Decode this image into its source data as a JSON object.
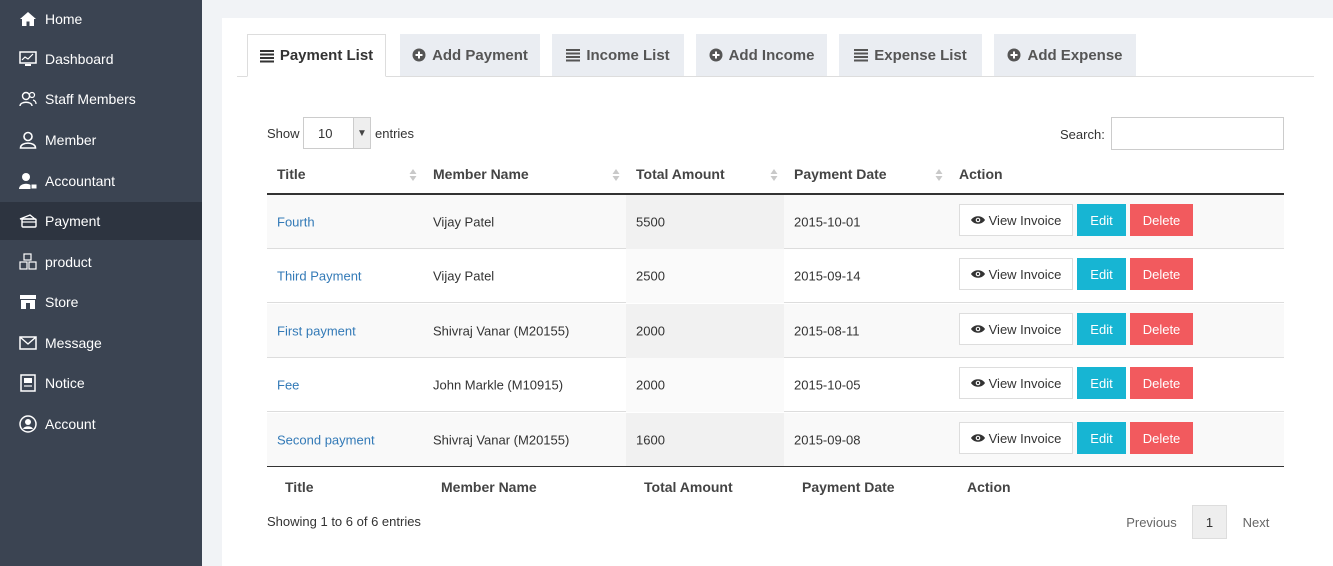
{
  "sidebar": {
    "items": [
      {
        "label": "Home",
        "icon": "home-icon"
      },
      {
        "label": "Dashboard",
        "icon": "monitor-icon"
      },
      {
        "label": "Staff Members",
        "icon": "users-icon"
      },
      {
        "label": "Member",
        "icon": "user-icon"
      },
      {
        "label": "Accountant",
        "icon": "accountant-icon"
      },
      {
        "label": "Payment",
        "icon": "payment-icon",
        "active": true
      },
      {
        "label": "product",
        "icon": "boxes-icon"
      },
      {
        "label": "Store",
        "icon": "store-icon"
      },
      {
        "label": "Message",
        "icon": "envelope-icon"
      },
      {
        "label": "Notice",
        "icon": "notice-icon"
      },
      {
        "label": "Account",
        "icon": "account-icon"
      }
    ]
  },
  "tabs": [
    {
      "label": "Payment List",
      "icon": "list-icon",
      "active": true
    },
    {
      "label": "Add Payment",
      "icon": "plus-circle-icon"
    },
    {
      "label": "Income List",
      "icon": "list-icon"
    },
    {
      "label": "Add Income",
      "icon": "plus-circle-icon"
    },
    {
      "label": "Expense List",
      "icon": "list-icon"
    },
    {
      "label": "Add Expense",
      "icon": "plus-circle-icon"
    }
  ],
  "table": {
    "show_label": "Show",
    "page_size": "10",
    "entries_label": "entries",
    "search_label": "Search:",
    "search_value": "",
    "columns": [
      "Title",
      "Member Name",
      "Total Amount",
      "Payment Date",
      "Action"
    ],
    "rows": [
      {
        "title": "Fourth",
        "member": "Vijay Patel",
        "amount": "5500",
        "date": "2015-10-01"
      },
      {
        "title": "Third Payment",
        "member": "Vijay Patel",
        "amount": "2500",
        "date": "2015-09-14"
      },
      {
        "title": "First payment",
        "member": "Shivraj Vanar (M20155)",
        "amount": "2000",
        "date": "2015-08-11"
      },
      {
        "title": "Fee",
        "member": "John Markle (M10915)",
        "amount": "2000",
        "date": "2015-10-05"
      },
      {
        "title": "Second payment",
        "member": "Shivraj Vanar (M20155)",
        "amount": "1600",
        "date": "2015-09-08"
      }
    ],
    "actions": {
      "view": "View Invoice",
      "edit": "Edit",
      "delete": "Delete"
    },
    "info": "Showing 1 to 6 of 6 entries",
    "pagination": {
      "previous": "Previous",
      "current": "1",
      "next": "Next"
    }
  },
  "colors": {
    "sidebar_bg": "#3b4452",
    "sidebar_active": "#2d3440",
    "edit_button": "#17b5d3",
    "delete_button": "#f25a5e",
    "link": "#337ab7"
  }
}
